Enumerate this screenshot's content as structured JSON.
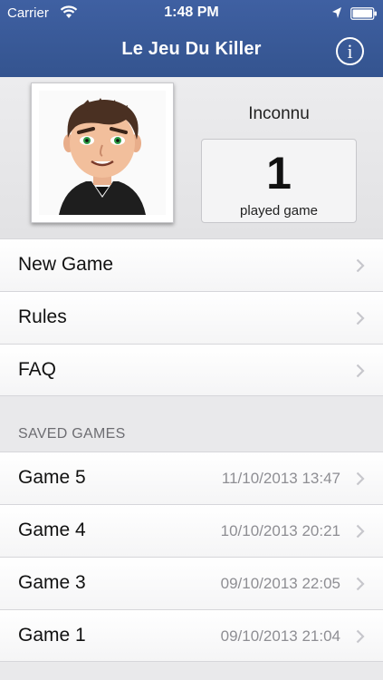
{
  "status_bar": {
    "carrier": "Carrier",
    "time": "1:48 PM",
    "icons": [
      "wifi-icon",
      "location-arrow-icon",
      "battery-icon"
    ]
  },
  "nav": {
    "title": "Le Jeu Du Killer",
    "info_icon": "info-icon",
    "info_glyph": "i"
  },
  "profile": {
    "name": "Inconnu",
    "played_count": "1",
    "played_label": "played game",
    "avatar_icon": "avatar-cartoon-man"
  },
  "menu": [
    {
      "label": "New Game"
    },
    {
      "label": "Rules"
    },
    {
      "label": "FAQ"
    }
  ],
  "saved_games": {
    "header": "SAVED GAMES",
    "items": [
      {
        "label": "Game 5",
        "date": "11/10/2013 13:47"
      },
      {
        "label": "Game 4",
        "date": "10/10/2013 20:21"
      },
      {
        "label": "Game 3",
        "date": "09/10/2013 22:05"
      },
      {
        "label": "Game 1",
        "date": "09/10/2013 21:04"
      }
    ]
  },
  "colors": {
    "nav_bar": "#3a5a9c",
    "background": "#e9e9eb",
    "secondary_text": "#8e8e93",
    "chevron": "#c7c7cc"
  }
}
